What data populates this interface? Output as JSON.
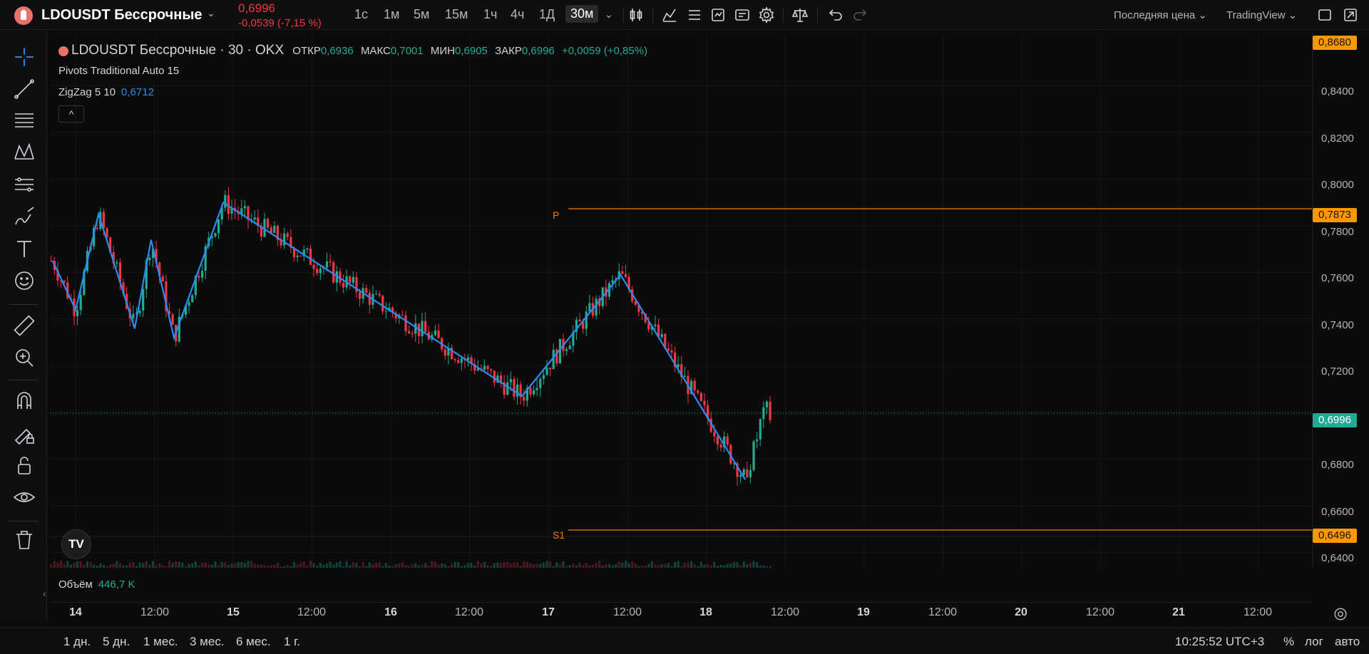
{
  "header": {
    "symbol": "LDOUSDT Бессрочные",
    "price": "0,6996",
    "change": "-0,0539 (-7,15 %)",
    "timeframes": [
      "1с",
      "1м",
      "5м",
      "15м",
      "1ч",
      "4ч",
      "1Д",
      "30м"
    ],
    "price_type": "Последняя цена",
    "chart_provider": "TradingView"
  },
  "legend": {
    "symbol": "LDOUSDT Бессрочные · 30 · OKX",
    "open_label": "ОТКР",
    "open": "0,6936",
    "high_label": "МАКС",
    "high": "0,7001",
    "low_label": "МИН",
    "low": "0,6905",
    "close_label": "ЗАКР",
    "close": "0,6996",
    "change": "+0,0059 (+0,85%)",
    "pivots": "Pivots Traditional Auto 15",
    "zigzag_name": "ZigZag 5 10",
    "zigzag_value": "0,6712",
    "collapse": "^"
  },
  "volume": {
    "label": "Объём",
    "value": "446,7 K"
  },
  "price_axis": {
    "ticks": [
      "0,8400",
      "0,8200",
      "0,8000",
      "0,7800",
      "0,7600",
      "0,7400",
      "0,7200",
      "0,6800",
      "0,6600",
      "0,6400"
    ],
    "badge_top": "0,8680",
    "badge_pivot": "0,7873",
    "badge_last": "0,6996",
    "badge_s1": "0,6496"
  },
  "pivots": {
    "p_label": "P",
    "s1_label": "S1"
  },
  "time_axis": [
    "14",
    "12:00",
    "15",
    "12:00",
    "16",
    "12:00",
    "17",
    "12:00",
    "18",
    "12:00",
    "19",
    "12:00",
    "20",
    "12:00",
    "21",
    "12:00"
  ],
  "bottom": {
    "ranges": [
      "1 дн.",
      "5 дн.",
      "1 мес.",
      "3 мес.",
      "6 мес.",
      "1 г."
    ],
    "clock": "10:25:52 UTC+3",
    "percent": "%",
    "log": "лог",
    "auto": "авто"
  },
  "colors": {
    "up": "#22ab94",
    "down": "#f23645",
    "zigzag": "#2a8bf2",
    "pivot": "#f57c00",
    "badge": "#ff9800"
  },
  "icons": [
    "crosshair-icon",
    "trendline-icon",
    "fib-icon",
    "pattern-icon",
    "prediction-icon",
    "brush-icon",
    "text-icon",
    "emoji-icon",
    "ruler-icon",
    "zoom-icon",
    "magnet-icon",
    "lock-draw-icon",
    "unlock-icon",
    "eye-icon",
    "trash-icon"
  ],
  "chart_data": {
    "type": "candlestick",
    "zigzag": [
      {
        "x": "13 20:30",
        "y": 0.765
      },
      {
        "x": "14 00:00",
        "y": 0.744
      },
      {
        "x": "14 03:30",
        "y": 0.785
      },
      {
        "x": "14 09:00",
        "y": 0.736
      },
      {
        "x": "14 11:30",
        "y": 0.774
      },
      {
        "x": "14 15:00",
        "y": 0.732
      },
      {
        "x": "14 22:30",
        "y": 0.79
      },
      {
        "x": "16 20:00",
        "y": 0.707
      },
      {
        "x": "17 11:00",
        "y": 0.759
      },
      {
        "x": "18 06:00",
        "y": 0.6712
      }
    ],
    "pivot_lines": [
      {
        "name": "P",
        "y": 0.7873
      },
      {
        "name": "S1",
        "y": 0.6496
      }
    ],
    "last_price": 0.6996,
    "ylim": [
      0.635,
      0.871
    ]
  }
}
